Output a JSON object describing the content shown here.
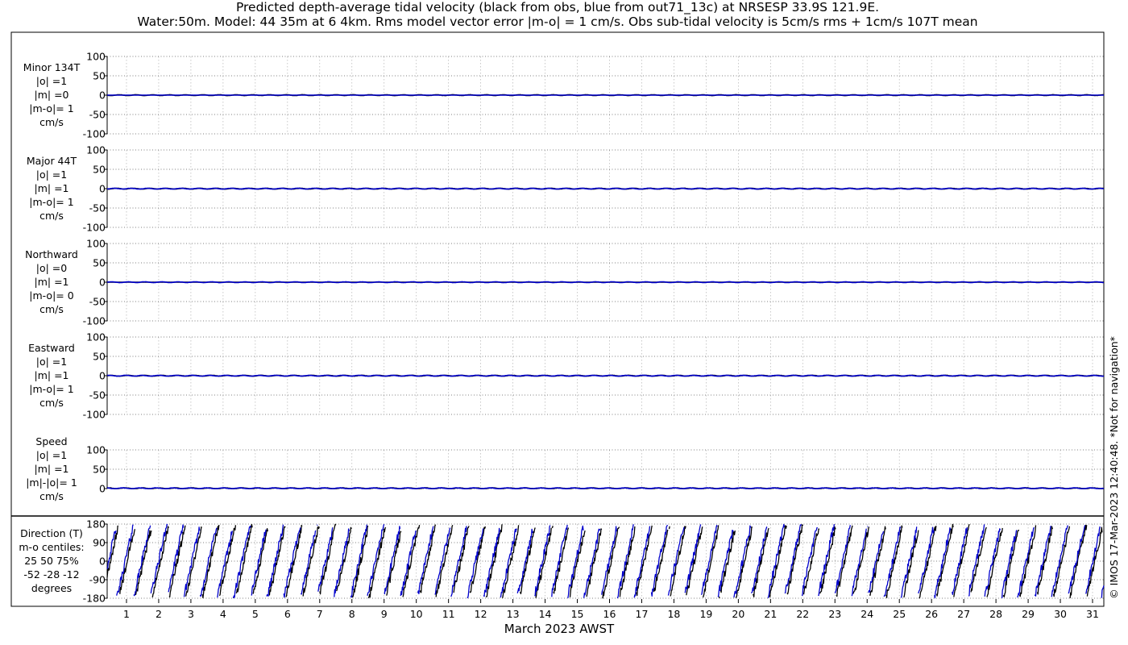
{
  "title": {
    "line1": "Predicted depth-average tidal velocity (black from obs, blue from out71_13c) at NRSESP 33.9S 121.9E.",
    "line2": "Water:50m. Model: 44 35m at 6 4km. Rms model vector error |m-o| = 1 cm/s. Obs sub-tidal velocity is 5cm/s rms + 1cm/s 107T mean"
  },
  "side_note": "© IMOS 17-Mar-2023 12:40:48. *Not for navigation*",
  "colors": {
    "obs": "#000000",
    "model": "#0000cc",
    "grid": "#b3b3b3"
  },
  "chart_data": {
    "type": "line",
    "xlabel": "March 2023 AWST",
    "x_ticks": [
      "1",
      "2",
      "3",
      "4",
      "5",
      "6",
      "7",
      "8",
      "9",
      "10",
      "11",
      "12",
      "13",
      "14",
      "15",
      "16",
      "17",
      "18",
      "19",
      "20",
      "21",
      "22",
      "23",
      "24",
      "25",
      "26",
      "27",
      "28",
      "29",
      "30",
      "31"
    ],
    "xlim": [
      0.4,
      31.35
    ],
    "grid": true,
    "panels": [
      {
        "label_lines": [
          "Minor 134T",
          "|o| =1",
          "|m| =0",
          "|m-o|= 1",
          "cm/s"
        ],
        "ylim": [
          -100,
          100
        ],
        "y_ticks": [
          "100",
          "50",
          "0",
          "-50",
          "-100"
        ],
        "y_tick_values": [
          100,
          50,
          0,
          -50,
          -100
        ],
        "obs_amp": 1,
        "model_amp": 0
      },
      {
        "label_lines": [
          "Major 44T",
          "|o| =1",
          "|m| =1",
          "|m-o|= 1",
          "cm/s"
        ],
        "ylim": [
          -100,
          100
        ],
        "y_ticks": [
          "100",
          "50",
          "0",
          "-50",
          "-100"
        ],
        "y_tick_values": [
          100,
          50,
          0,
          -50,
          -100
        ],
        "obs_amp": 1,
        "model_amp": 1
      },
      {
        "label_lines": [
          "Northward",
          "|o| =0",
          "|m| =1",
          "|m-o|= 0",
          "cm/s"
        ],
        "ylim": [
          -100,
          100
        ],
        "y_ticks": [
          "100",
          "50",
          "0",
          "-50",
          "-100"
        ],
        "y_tick_values": [
          100,
          50,
          0,
          -50,
          -100
        ],
        "obs_amp": 0,
        "model_amp": 1
      },
      {
        "label_lines": [
          "Eastward",
          "|o| =1",
          "|m| =1",
          "|m-o|= 1",
          "cm/s"
        ],
        "ylim": [
          -100,
          100
        ],
        "y_ticks": [
          "100",
          "50",
          "0",
          "-50",
          "-100"
        ],
        "y_tick_values": [
          100,
          50,
          0,
          -50,
          -100
        ],
        "obs_amp": 1,
        "model_amp": 1
      },
      {
        "label_lines": [
          "Speed",
          "|o| =1",
          "|m| =1",
          "|m|-|o|= 1",
          "cm/s"
        ],
        "ylim": [
          0,
          100
        ],
        "y_ticks": [
          "100",
          "50",
          "0"
        ],
        "y_tick_values": [
          100,
          50,
          0
        ],
        "obs_amp": 1,
        "model_amp": 1
      },
      {
        "label_lines": [
          "Direction (T)",
          "m-o centiles:",
          "25  50  75%",
          "-52 -28 -12",
          "degrees"
        ],
        "ylim": [
          -180,
          180
        ],
        "y_ticks": [
          "180",
          "90",
          "0",
          "-90",
          "-180"
        ],
        "y_tick_values": [
          180,
          90,
          0,
          -90,
          -180
        ],
        "obs_amp": 180,
        "model_amp": 180
      }
    ]
  }
}
